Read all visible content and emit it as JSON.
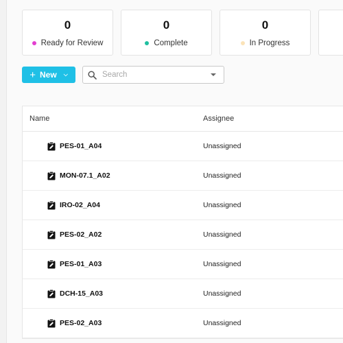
{
  "stats": [
    {
      "value": "0",
      "label": "Ready for Review",
      "color": "#e33fd0"
    },
    {
      "value": "0",
      "label": "Complete",
      "color": "#1fbfa0"
    },
    {
      "value": "0",
      "label": "In Progress",
      "color": "#fbe3b8"
    }
  ],
  "toolbar": {
    "new_label": "New",
    "search_placeholder": "Search"
  },
  "table": {
    "headers": {
      "name": "Name",
      "assignee": "Assignee"
    },
    "rows": [
      {
        "name": "PES-01_A04",
        "assignee": "Unassigned"
      },
      {
        "name": "MON-07.1_A02",
        "assignee": "Unassigned"
      },
      {
        "name": "IRO-02_A04",
        "assignee": "Unassigned"
      },
      {
        "name": "PES-02_A02",
        "assignee": "Unassigned"
      },
      {
        "name": "PES-01_A03",
        "assignee": "Unassigned"
      },
      {
        "name": "DCH-15_A03",
        "assignee": "Unassigned"
      },
      {
        "name": "PES-02_A03",
        "assignee": "Unassigned"
      }
    ]
  },
  "icons": {
    "row": "task-edit-icon",
    "search": "search-icon"
  }
}
